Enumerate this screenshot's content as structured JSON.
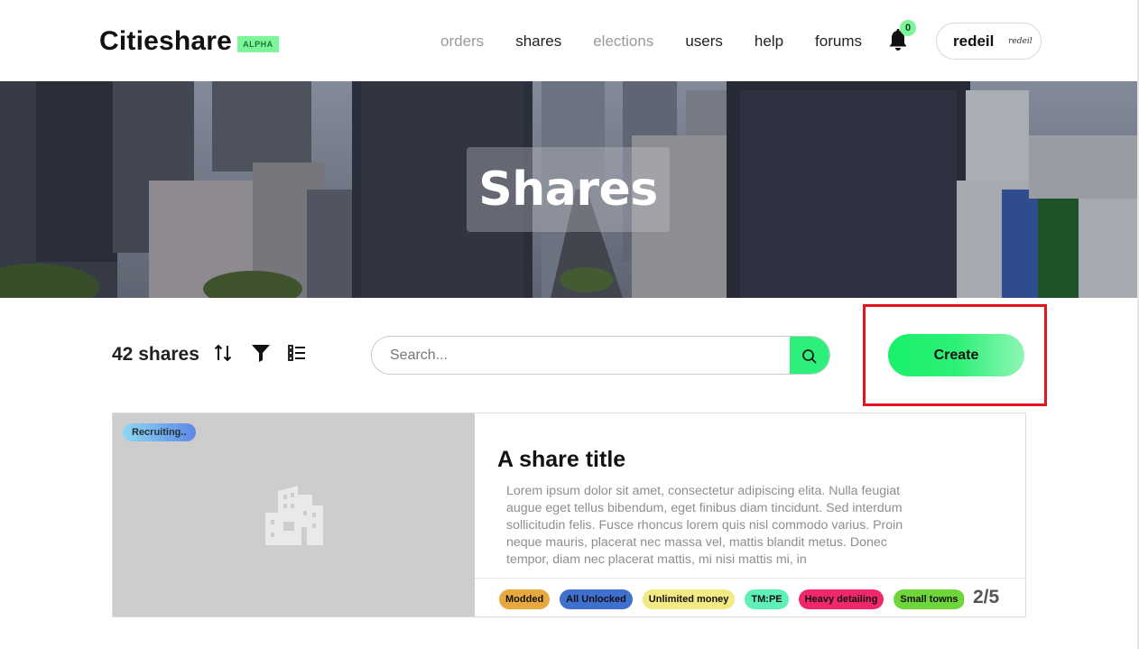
{
  "brand": {
    "name": "Citieshare",
    "badge": "ALPHA"
  },
  "nav": [
    {
      "label": "orders",
      "muted": true
    },
    {
      "label": "shares",
      "muted": false
    },
    {
      "label": "elections",
      "muted": true
    },
    {
      "label": "users",
      "muted": false
    },
    {
      "label": "help",
      "muted": false
    },
    {
      "label": "forums",
      "muted": false
    }
  ],
  "notifications": {
    "count": "0",
    "icon": "bell-icon"
  },
  "user": {
    "name": "redeil",
    "avatar_text": "redeil"
  },
  "hero": {
    "title": "Shares"
  },
  "toolbar": {
    "count_label": "42 shares",
    "sort_icon": "sort-icon",
    "filter_icon": "filter-icon",
    "list_icon": "list-view-icon",
    "search_placeholder": "Search...",
    "search_value": "",
    "create_label": "Create"
  },
  "card": {
    "status": "Recruiting..",
    "title": "A share title",
    "description": "Lorem ipsum dolor sit amet, consectetur adipiscing elita. Nulla feugiat augue eget tellus bibendum, eget finibus diam tincidunt. Sed interdum sollicitudin felis. Fusce rhoncus lorem quis nisl commodo varius. Proin neque mauris, placerat nec massa vel, mattis blandit metus. Donec tempor, diam nec placerat mattis, mi nisi mattis mi, in",
    "tags": [
      {
        "label": "Modded",
        "color": "#e7a93d"
      },
      {
        "label": "All Unlocked",
        "color": "#3f6fcf"
      },
      {
        "label": "Unlimited money",
        "color": "#f3ea84"
      },
      {
        "label": "TM:PE",
        "color": "#5ef0b8"
      },
      {
        "label": "Heavy detailing",
        "color": "#f0286a"
      },
      {
        "label": "Small towns",
        "color": "#6fd63a"
      },
      {
        "label": "",
        "color": "#f3d24c"
      }
    ],
    "pager": "2/5"
  },
  "colors": {
    "accent": "#2df07c",
    "highlight": "#e3161d"
  }
}
